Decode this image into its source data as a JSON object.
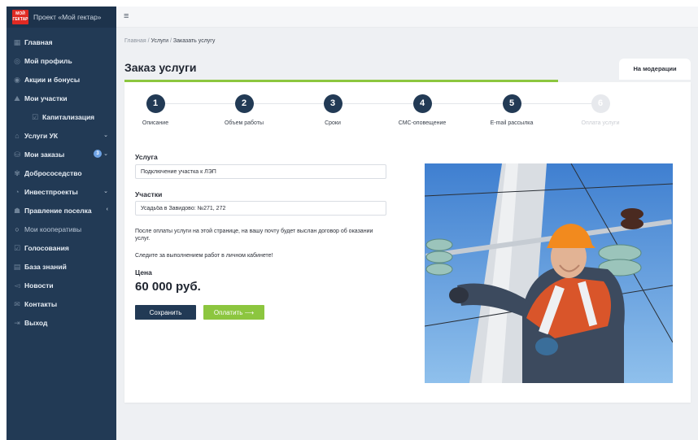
{
  "app": {
    "title": "Проект «Мой гектар»",
    "logo_text": "МОЙ ГЕКТАР",
    "menu_icon": "hamburger-icon"
  },
  "sidebar": {
    "items": [
      {
        "label": "Главная",
        "icon": "grid-icon"
      },
      {
        "label": "Мой профиль",
        "icon": "user-icon"
      },
      {
        "label": "Акции и бонусы",
        "icon": "gift-icon"
      },
      {
        "label": "Мои участки",
        "icon": "map-icon"
      },
      {
        "label": "Капитализация",
        "icon": "check-icon"
      },
      {
        "label": "Услуги УК",
        "icon": "building-icon"
      },
      {
        "label": "Мои заказы",
        "icon": "cart-icon",
        "badge": "3"
      },
      {
        "label": "Добрососедство",
        "icon": "handshake-icon"
      },
      {
        "label": "Инвестпроекты",
        "icon": "invest-icon"
      },
      {
        "label": "Правление поселка",
        "icon": "team-icon"
      },
      {
        "label": "Мои кооперативы",
        "icon": "circle-icon"
      },
      {
        "label": "Голосования",
        "icon": "vote-icon"
      },
      {
        "label": "База знаний",
        "icon": "book-icon"
      },
      {
        "label": "Новости",
        "icon": "megaphone-icon"
      },
      {
        "label": "Контакты",
        "icon": "contacts-icon"
      },
      {
        "label": "Выход",
        "icon": "logout-icon"
      }
    ]
  },
  "breadcrumb": {
    "home": "Главная",
    "sep1": " / ",
    "services": "Услуги",
    "sep2": " / ",
    "current": "Заказать услугу"
  },
  "page": {
    "title": "Заказ услуги",
    "status_tab": "На модерации"
  },
  "steps": [
    {
      "number": "1",
      "label": "Описание",
      "active": true
    },
    {
      "number": "2",
      "label": "Объем работы",
      "active": true
    },
    {
      "number": "3",
      "label": "Сроки",
      "active": true
    },
    {
      "number": "4",
      "label": "СМС-оповещение",
      "active": true
    },
    {
      "number": "5",
      "label": "E-mail рассылка",
      "active": true
    },
    {
      "number": "6",
      "label": "Оплата услуги",
      "active": false
    }
  ],
  "form": {
    "service_label": "Услуга",
    "service_value": "Подключение участка к ЛЭП",
    "plots_label": "Участки",
    "plots_value": "Усадьба в Завидово: №271, 272",
    "note1": "После оплаты услуги на этой странице, на вашу почту будет выслан договор об оказании услуг.",
    "note2": "Следите за выполнением работ в личном кабинете!",
    "price_label": "Цена",
    "price_value": "60 000 руб.",
    "save_label": "Сохранить",
    "pay_label": "Оплатить ⟶"
  },
  "colors": {
    "sidebar_bg": "#223a55",
    "accent_green": "#8cc63f",
    "step_active": "#223a55",
    "step_inactive": "#e7e9ed",
    "logo_red": "#e02a23"
  }
}
